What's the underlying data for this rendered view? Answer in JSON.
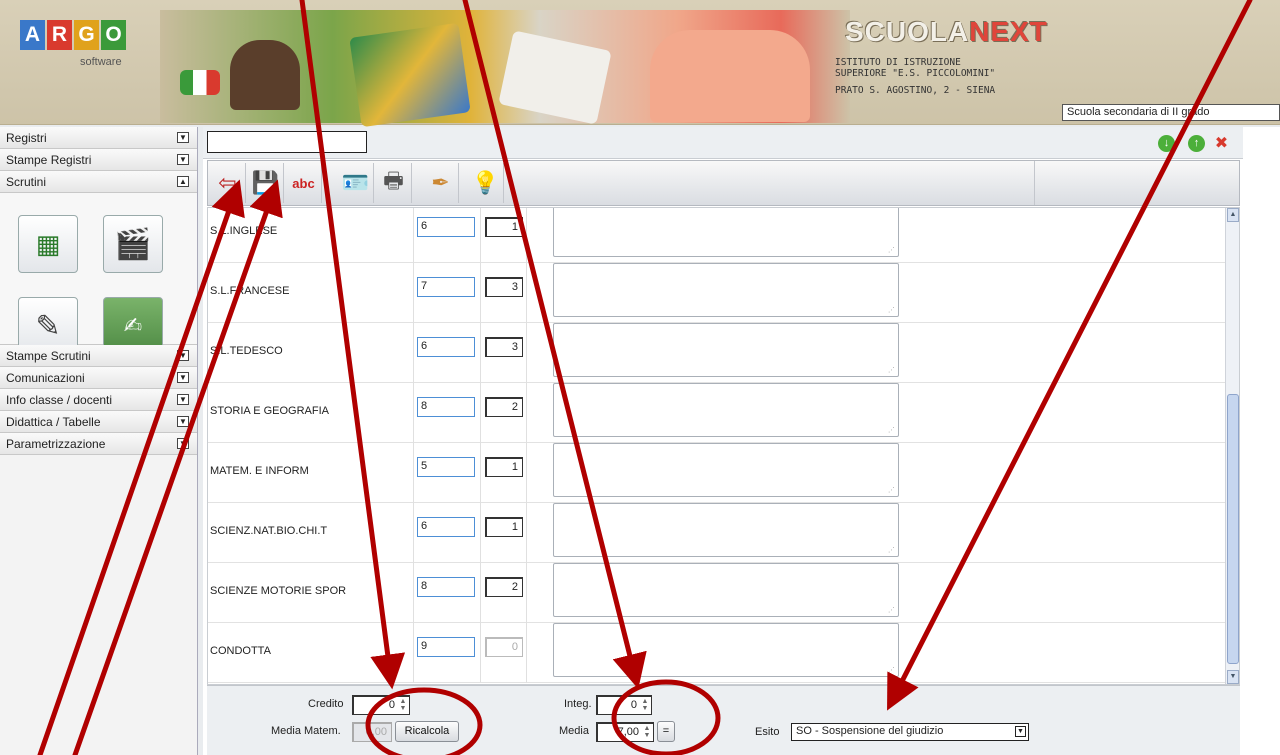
{
  "header": {
    "logo_letters": [
      "A",
      "R",
      "G",
      "O"
    ],
    "logo_colors": [
      "#3a78c9",
      "#d93a2e",
      "#e0a21c",
      "#3b9a3a"
    ],
    "logo_subtitle": "software",
    "brand_part1": "SCUOLA",
    "brand_part2": "NEXT",
    "institute_line1": "ISTITUTO DI ISTRUZIONE",
    "institute_line2": "SUPERIORE \"E.S. PICCOLOMINI\"",
    "institute_address": "PRATO S. AGOSTINO, 2 - SIENA",
    "school_level": "Scuola secondaria di II grado"
  },
  "sidebar": {
    "items_top": [
      {
        "label": "Registri"
      },
      {
        "label": "Stampe Registri"
      },
      {
        "label": "Scrutini"
      }
    ],
    "items_bottom": [
      {
        "label": "Stampe Scrutini"
      },
      {
        "label": "Comunicazioni"
      },
      {
        "label": "Info classe / docenti"
      },
      {
        "label": "Didattica / Tabelle"
      },
      {
        "label": "Parametrizzazione"
      }
    ],
    "scrutini_icons": [
      "grades-grid-icon",
      "clapperboard-icon",
      "edit-notes-icon",
      "blackboard-icon"
    ]
  },
  "toolbar": {
    "buttons": [
      "exit-icon",
      "save-icon",
      "spellcheck-icon",
      "id-card-icon",
      "print-icon",
      "signature-icon",
      "lightbulb-icon"
    ]
  },
  "topbar_buttons": {
    "down": {
      "color": "#4caf3a",
      "glyph": "↓"
    },
    "up": {
      "color": "#4caf3a",
      "glyph": "↑"
    },
    "close": {
      "color": "#d83a2e",
      "glyph": "✖"
    }
  },
  "grid": {
    "rows": [
      {
        "subject": "S.L.INGLESE",
        "grade": "6",
        "absences": "1",
        "disabled": false
      },
      {
        "subject": "S.L.FRANCESE",
        "grade": "7",
        "absences": "3",
        "disabled": false
      },
      {
        "subject": "S.L.TEDESCO",
        "grade": "6",
        "absences": "3",
        "disabled": false
      },
      {
        "subject": "STORIA E GEOGRAFIA",
        "grade": "8",
        "absences": "2",
        "disabled": false
      },
      {
        "subject": "MATEM. E INFORM",
        "grade": "5",
        "absences": "1",
        "disabled": false
      },
      {
        "subject": "SCIENZ.NAT.BIO.CHI.T",
        "grade": "6",
        "absences": "1",
        "disabled": false
      },
      {
        "subject": "SCIENZE MOTORIE SPOR",
        "grade": "8",
        "absences": "2",
        "disabled": false
      },
      {
        "subject": "CONDOTTA",
        "grade": "9",
        "absences": "0",
        "disabled": true
      }
    ]
  },
  "footer": {
    "credito_label": "Credito",
    "credito_value": "0",
    "media_matem_label": "Media Matem.",
    "media_matem_value": "0,00",
    "ricalcola_label": "Ricalcola",
    "integ_label": "Integ.",
    "integ_value": "0",
    "media_label": "Media",
    "media_value": "7,00",
    "equals_label": "=",
    "esito_label": "Esito",
    "esito_value": "SO - Sospensione del giudizio"
  },
  "annotation_color": "#b00000"
}
